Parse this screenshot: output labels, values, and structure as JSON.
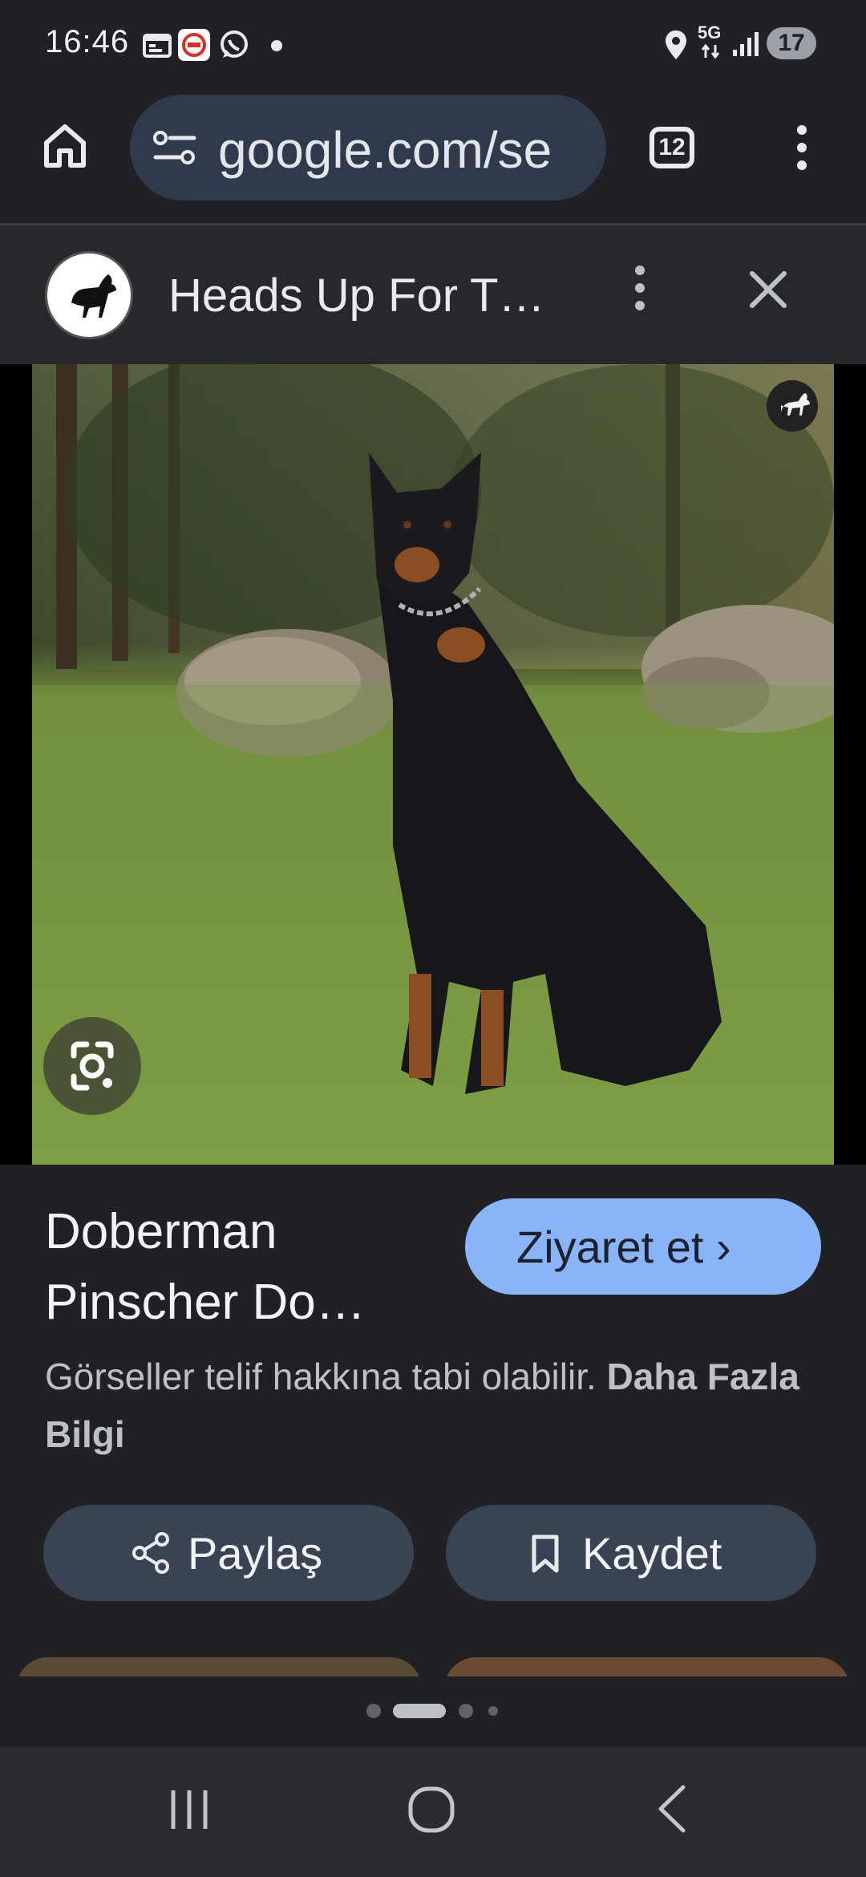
{
  "status_bar": {
    "time": "16:46",
    "network_label": "5G",
    "battery_level": "17",
    "icons": [
      "calendar-icon",
      "tcl-app-icon",
      "whatsapp-icon",
      "notification-dot-icon",
      "location-icon",
      "signal-icon",
      "battery-icon"
    ]
  },
  "browser": {
    "url": "google.com/se",
    "tab_count": "12",
    "icons": [
      "home-icon",
      "site-info-icon",
      "tab-switcher-icon",
      "more-menu-icon"
    ]
  },
  "sheet": {
    "source_title": "Heads Up For T…",
    "icons": [
      "source-avatar-icon",
      "more-vert-icon",
      "close-icon"
    ]
  },
  "image": {
    "alt": "Doberman Pinscher photo",
    "icons": [
      "google-lens-icon",
      "source-badge-icon"
    ]
  },
  "info": {
    "title_line1": "Doberman",
    "title_line2": "Pinscher Do…",
    "visit_label": "Ziyaret et ›",
    "copyright_text": "Görseller telif hakkına tabi olabilir. ",
    "copyright_link": "Daha Fazla Bilgi"
  },
  "actions": {
    "share_label": "Paylaş",
    "save_label": "Kaydet"
  },
  "pagination": {
    "active_index": 1,
    "count": 4
  },
  "colors": {
    "background": "#202124",
    "accent_button": "#8ab4f8",
    "action_button": "#3a4354",
    "omnibox": "#303a4c"
  }
}
